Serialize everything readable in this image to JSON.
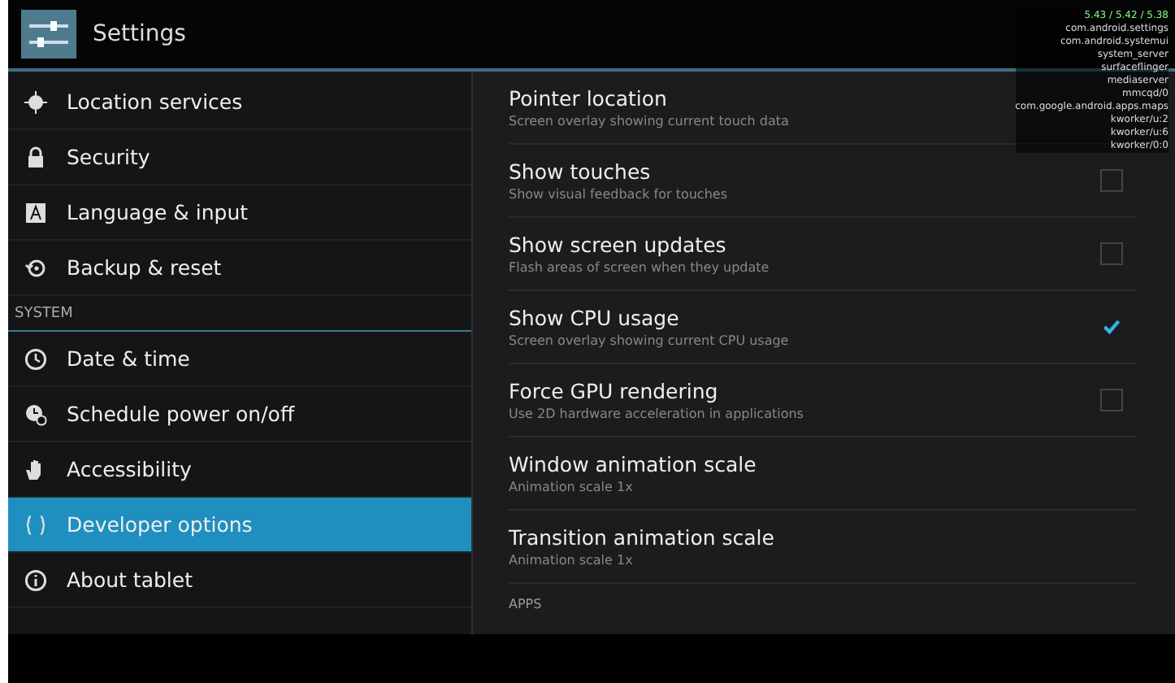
{
  "action_bar": {
    "title": "Settings"
  },
  "sidebar": {
    "items": [
      {
        "kind": "item",
        "label": "Location services",
        "selected": false
      },
      {
        "kind": "item",
        "label": "Security",
        "selected": false
      },
      {
        "kind": "item",
        "label": "Language & input",
        "selected": false
      },
      {
        "kind": "item",
        "label": "Backup & reset",
        "selected": false
      },
      {
        "kind": "header",
        "label": "SYSTEM"
      },
      {
        "kind": "item",
        "label": "Date & time",
        "selected": false
      },
      {
        "kind": "item",
        "label": "Schedule power on/off",
        "selected": false
      },
      {
        "kind": "item",
        "label": "Accessibility",
        "selected": false
      },
      {
        "kind": "item",
        "label": "Developer options",
        "selected": true
      },
      {
        "kind": "item",
        "label": "About tablet",
        "selected": false
      }
    ]
  },
  "options": [
    {
      "kind": "plain",
      "title": "Pointer location",
      "summary": "Screen overlay showing current touch data"
    },
    {
      "kind": "checkbox",
      "title": "Show touches",
      "summary": "Show visual feedback for touches",
      "checked": false
    },
    {
      "kind": "checkbox",
      "title": "Show screen updates",
      "summary": "Flash areas of screen when they update",
      "checked": false
    },
    {
      "kind": "checkbox",
      "title": "Show CPU usage",
      "summary": "Screen overlay showing current CPU usage",
      "checked": true
    },
    {
      "kind": "checkbox",
      "title": "Force GPU rendering",
      "summary": "Use 2D hardware acceleration in applications",
      "checked": false
    },
    {
      "kind": "plain",
      "title": "Window animation scale",
      "summary": "Animation scale 1x"
    },
    {
      "kind": "plain",
      "title": "Transition animation scale",
      "summary": "Animation scale 1x"
    },
    {
      "kind": "header",
      "title": "APPS"
    }
  ],
  "cpu_overlay": {
    "load": "5.43 / 5.42 / 5.38",
    "processes": [
      "com.android.settings",
      "com.android.systemui",
      "system_server",
      "surfaceflinger",
      "mediaserver",
      "mmcqd/0",
      "com.google.android.apps.maps",
      "kworker/u:2",
      "kworker/u:6",
      "kworker/0:0"
    ]
  }
}
